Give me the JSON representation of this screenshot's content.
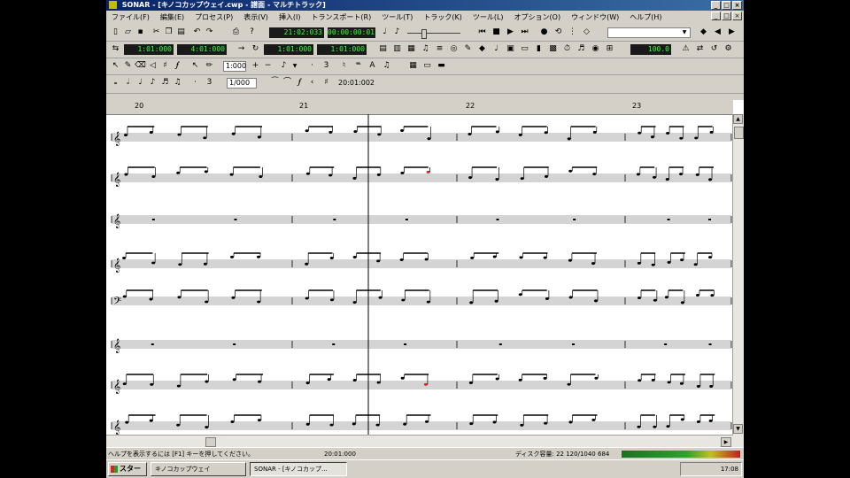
{
  "window": {
    "title": "SONAR - [キノコカップウェイ.cwp - 譜面 - マルチトラック]",
    "controls": {
      "minimize": "_",
      "maximize": "□",
      "close": "×"
    }
  },
  "menu": [
    "ファイル(F)",
    "編集(E)",
    "プロセス(P)",
    "表示(V)",
    "挿入(I)",
    "トランスポート(R)",
    "ツール(T)",
    "トラック(K)",
    "ツール(L)",
    "オプション(O)",
    "ウィンドウ(W)",
    "ヘルプ(H)"
  ],
  "transport": {
    "now_time": "21:02:033",
    "time_lcd_2": "00:00:00:01",
    "loop_start": "1:01:000",
    "loop_end": "4:01:000",
    "punch_start": "1:01:000",
    "punch_end": "1:01:000",
    "cpu": "100.0"
  },
  "score_toolbar": {
    "resolution": "1:000",
    "snap": "1/000",
    "position": "20:01:002"
  },
  "ruler": {
    "measures": [
      "20",
      "21",
      "22",
      "23"
    ]
  },
  "status": {
    "help_text": "ヘルプを表示するには [F1] キーを押してください。",
    "position_text": "20:01:000",
    "disk_text": "ディスク容量: 22 120/1040 684"
  },
  "taskbar": {
    "start": "スタート",
    "items": [
      "キノコカップウェイ",
      "SONAR - [キノコカップ..."
    ],
    "clock": "17:08"
  },
  "colors": {
    "lcd_text": "#39ff39",
    "title_gradient_start": "#0a246a",
    "selected_note": "#e02020"
  }
}
